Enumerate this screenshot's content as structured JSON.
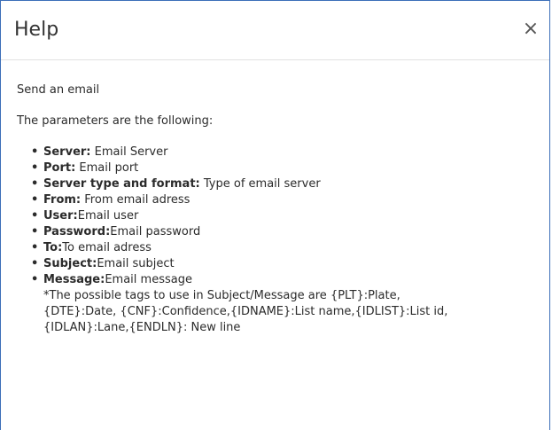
{
  "dialog": {
    "title": "Help",
    "close_glyph": "×"
  },
  "body": {
    "intro": "Send an email",
    "params_intro": "The parameters are the following:",
    "params": [
      {
        "name": "Server:",
        "desc": " Email Server"
      },
      {
        "name": "Port:",
        "desc": " Email port"
      },
      {
        "name": "Server type and format:",
        "desc": " Type of email server"
      },
      {
        "name": "From:",
        "desc": " From email adress"
      },
      {
        "name": "User:",
        "desc": "Email user"
      },
      {
        "name": "Password:",
        "desc": "Email password"
      },
      {
        "name": "To:",
        "desc": "To email adress"
      },
      {
        "name": "Subject:",
        "desc": "Email subject"
      },
      {
        "name": "Message:",
        "desc": "Email message"
      }
    ],
    "note_line_1": "*The possible tags to use in Subject/Message are {PLT}:Plate,",
    "note_line_2": "{DTE}:Date, {CNF}:Confidence,{IDNAME}:List name,{IDLIST}:List id,",
    "note_line_3": "{IDLAN}:Lane,{ENDLN}: New line"
  }
}
